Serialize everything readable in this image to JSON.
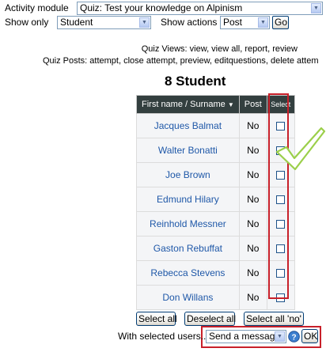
{
  "filters": {
    "activity_module_label": "Activity module",
    "activity_module_value": "Quiz: Test your knowledge on Alpinism",
    "show_only_label": "Show only",
    "show_only_value": "Student",
    "show_actions_label": "Show actions",
    "show_actions_value": "Post",
    "go_label": "Go"
  },
  "info": {
    "quiz_views": "Quiz Views: view, view all, report, review",
    "quiz_posts": "Quiz Posts: attempt, close attempt, preview, editquestions, delete attem"
  },
  "title": "8 Student",
  "table": {
    "headers": {
      "first_name": "First name",
      "separator": "/",
      "surname": "Surname",
      "post": "Post",
      "select": "Select"
    },
    "rows": [
      {
        "name": "Jacques Balmat",
        "post": "No"
      },
      {
        "name": "Walter Bonatti",
        "post": "No"
      },
      {
        "name": "Joe Brown",
        "post": "No"
      },
      {
        "name": "Edmund Hilary",
        "post": "No"
      },
      {
        "name": "Reinhold Messner",
        "post": "No"
      },
      {
        "name": "Gaston Rebuffat",
        "post": "No"
      },
      {
        "name": "Rebecca Stevens",
        "post": "No"
      },
      {
        "name": "Don Willans",
        "post": "No"
      }
    ]
  },
  "buttons": {
    "select_all": "Select all",
    "deselect_all": "Deselect all",
    "select_all_no": "Select all 'no'"
  },
  "bulk": {
    "label": "With selected users...",
    "action_value": "Send a message",
    "ok_label": "OK"
  },
  "colors": {
    "header_bg": "#333f3f",
    "link": "#1f58a8",
    "highlight": "#c8202a",
    "check_mark": "#9bcf4a"
  }
}
